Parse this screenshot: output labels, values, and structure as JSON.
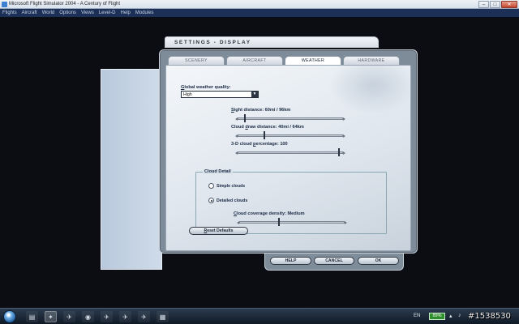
{
  "window": {
    "title": "Microsoft Flight Simulator 2004 - A Century of Flight",
    "min_glyph": "–",
    "max_glyph": "□",
    "close_glyph": "✕"
  },
  "menu": [
    "Flights",
    "Aircraft",
    "World",
    "Options",
    "Views",
    "Level-D",
    "Help",
    "Modules"
  ],
  "dialog": {
    "header_title": "SETTINGS - DISPLAY",
    "tabs": [
      {
        "label": "SCENERY",
        "active": false
      },
      {
        "label": "AIRCRAFT",
        "active": false
      },
      {
        "label": "WEATHER",
        "active": true
      },
      {
        "label": "HARDWARE",
        "active": false
      }
    ],
    "weather": {
      "global_quality_label_first": "G",
      "global_quality_label_rest": "lobal weather quality:",
      "global_quality_value": "High",
      "dropdown_arrow": "▼",
      "sight_label_first": "S",
      "sight_label_rest": "ight distance: 60mi / 96km",
      "sight_level": 0.07,
      "cloud_draw_label_first": "Cloud ",
      "cloud_draw_label_u": "d",
      "cloud_draw_label_rest": "raw distance: 40mi / 64km",
      "cloud_draw_level": 0.25,
      "cloud_pct_label_first": "3-D cloud ",
      "cloud_pct_label_u": "p",
      "cloud_pct_label_rest": "ercentage: 100",
      "cloud_pct_level": 0.96,
      "cloud_detail_title": "Cloud Detail",
      "simple_clouds_label": "Simple clouds",
      "detailed_clouds_label_u": "D",
      "detailed_clouds_label_rest": "etailed clouds",
      "cloud_detail_selected": "detailed",
      "coverage_label_first": "C",
      "coverage_label_rest": "loud coverage density: Medium",
      "coverage_level": 0.38,
      "reset_label_u": "R",
      "reset_label_rest": "eset Defaults"
    },
    "buttons": {
      "help": "HELP",
      "cancel": "CANCEL",
      "ok": "OK"
    }
  },
  "taskbar": {
    "icons": [
      "▤",
      "✦",
      "✈",
      "◉",
      "✈",
      "✈",
      "✈",
      "▦"
    ],
    "language": "EN",
    "battery": "89%",
    "tray_icons": [
      "▴",
      "♪"
    ]
  },
  "watermark": "#1538530"
}
